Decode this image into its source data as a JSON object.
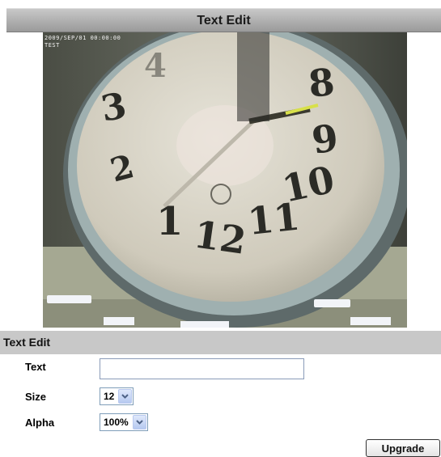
{
  "header": {
    "title": "Text Edit"
  },
  "preview": {
    "osd_timestamp": "2009/SEP/01 00:00:00",
    "osd_text": "TEST",
    "clock_numbers": [
      "3",
      "4",
      "2",
      "1",
      "12",
      "11",
      "10",
      "9",
      "8"
    ]
  },
  "section": {
    "title": "Text Edit"
  },
  "form": {
    "text": {
      "label": "Text",
      "value": ""
    },
    "size": {
      "label": "Size",
      "value": "12"
    },
    "alpha": {
      "label": "Alpha",
      "value": "100%"
    }
  },
  "actions": {
    "upgrade_label": "Upgrade"
  }
}
